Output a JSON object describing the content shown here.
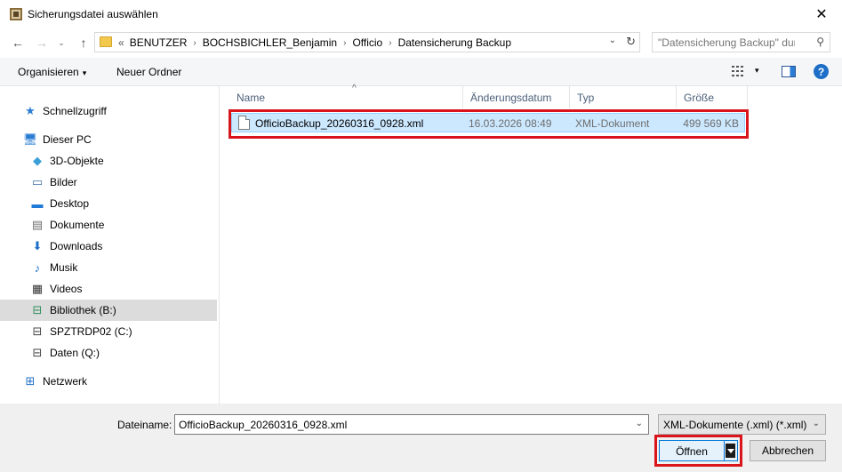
{
  "window": {
    "title": "Sicherungsdatei auswählen",
    "close_glyph": "✕"
  },
  "nav": {
    "back_glyph": "←",
    "forward_glyph": "→",
    "recent_glyph": "⌄",
    "up_glyph": "↑"
  },
  "address": {
    "lead": "«",
    "crumbs": [
      "BENUTZER",
      "BOCHSBICHLER_Benjamin",
      "Officio",
      "Datensicherung Backup"
    ],
    "separator": "›",
    "dropdown_glyph": "⌄",
    "refresh_glyph": "↻"
  },
  "search": {
    "placeholder": "\"Datensicherung Backup\" dur...",
    "icon_glyph": "⚲"
  },
  "toolbar": {
    "organize_label": "Organisieren",
    "organize_caret": "▾",
    "new_folder_label": "Neuer Ordner",
    "view_caret": "▾",
    "help_label": "?"
  },
  "sidebar": {
    "items": [
      {
        "label": "Schnellzugriff",
        "icon": "★",
        "color": "#2b7cd3"
      },
      {
        "label": "Dieser PC",
        "icon": "🖥",
        "color": "#2b7cd3"
      },
      {
        "label": "3D-Objekte",
        "icon": "◆",
        "color": "#3aa0d8"
      },
      {
        "label": "Bilder",
        "icon": "▭",
        "color": "#3b6ea5"
      },
      {
        "label": "Desktop",
        "icon": "▬",
        "color": "#1e7ad6"
      },
      {
        "label": "Dokumente",
        "icon": "▤",
        "color": "#6d6d6d"
      },
      {
        "label": "Downloads",
        "icon": "⬇",
        "color": "#1e6ec8"
      },
      {
        "label": "Musik",
        "icon": "♪",
        "color": "#1e6ec8"
      },
      {
        "label": "Videos",
        "icon": "▦",
        "color": "#333333"
      },
      {
        "label": "Bibliothek (B:)",
        "icon": "⊟",
        "color": "#2e8b57"
      },
      {
        "label": "SPZTRDP02 (C:)",
        "icon": "⊟",
        "color": "#444444"
      },
      {
        "label": "Daten (Q:)",
        "icon": "⊟",
        "color": "#444444"
      },
      {
        "label": "Netzwerk",
        "icon": "⊞",
        "color": "#1e6ec8"
      }
    ]
  },
  "columns": {
    "name": "Name",
    "date": "Änderungsdatum",
    "type": "Typ",
    "size": "Größe",
    "sort_caret": "^"
  },
  "files": [
    {
      "name": "OfficioBackup_20260316_0928.xml",
      "date": "16.03.2026 08:49",
      "type": "XML-Dokument",
      "size": "499 569 KB"
    }
  ],
  "footer": {
    "filename_label": "Dateiname:",
    "filename_value": "OfficioBackup_20260316_0928.xml",
    "filename_dropdown": "⌄",
    "filter_label": "XML-Dokumente (.xml) (*.xml)",
    "filter_dropdown": "⌄",
    "open_label": "Öffnen",
    "cancel_label": "Abbrechen"
  }
}
